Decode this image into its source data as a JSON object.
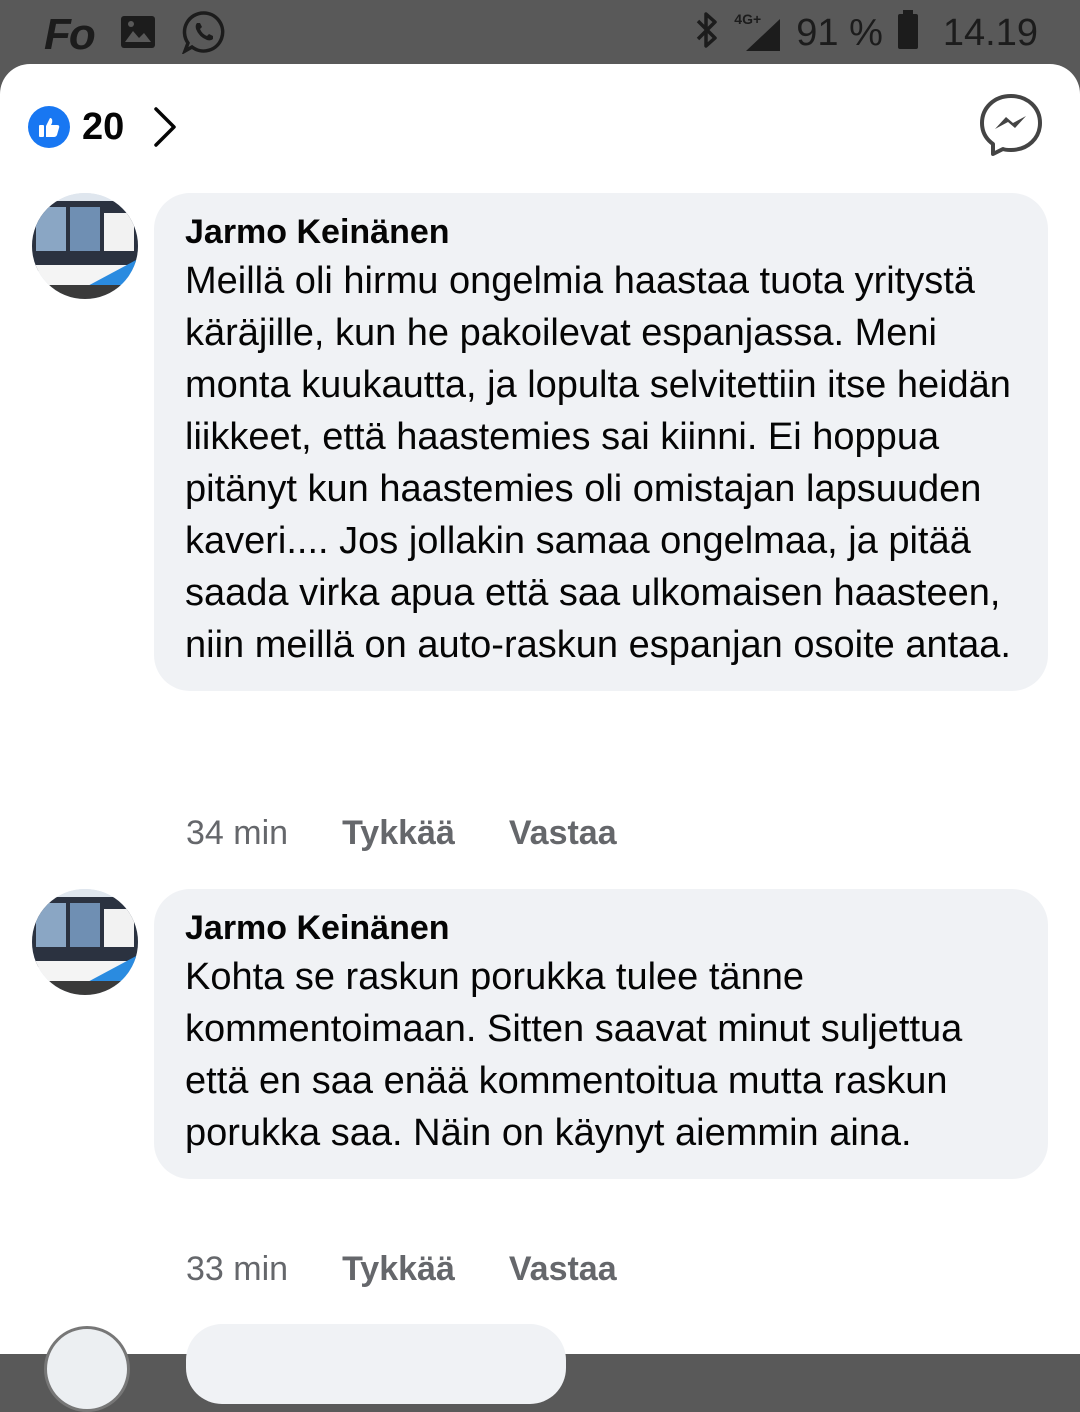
{
  "status_bar": {
    "app_letters": "Fo",
    "network": "4G+",
    "battery": "91 %",
    "time": "14.19",
    "icons": [
      "gallery-icon",
      "whatsapp-icon",
      "bluetooth-icon",
      "signal-icon",
      "battery-icon"
    ]
  },
  "header": {
    "reaction_icon": "like-icon",
    "reaction_count": "20",
    "messenger_icon": "messenger-icon"
  },
  "comments": [
    {
      "author": "Jarmo Keinänen",
      "text": "Meillä oli hirmu ongelmia haastaa tuota yritystä käräjille, kun he pakoilevat espanjassa. Meni monta kuukautta, ja lopulta selvitettiin itse heidän liikkeet, että haastemies sai kiinni. Ei hoppua pitänyt kun haastemies oli omistajan lapsuuden kaveri.... Jos jollakin samaa ongelmaa, ja pitää saada virka apua että saa ulkomaisen haasteen, niin meillä on auto-raskun espanjan osoite antaa.",
      "time": "34 min",
      "like_label": "Tykkää",
      "reply_label": "Vastaa"
    },
    {
      "author": "Jarmo Keinänen",
      "text": "Kohta se raskun porukka tulee tänne kommentoimaan. Sitten saavat minut suljettua että en saa enää kommentoitua mutta raskun porukka saa. Näin on käynyt aiemmin aina.",
      "time": "33 min",
      "like_label": "Tykkää",
      "reply_label": "Vastaa"
    }
  ],
  "colors": {
    "accent": "#1877f2",
    "bubble": "#f0f2f5",
    "meta_text": "#65676b",
    "status_bar": "#595959"
  }
}
